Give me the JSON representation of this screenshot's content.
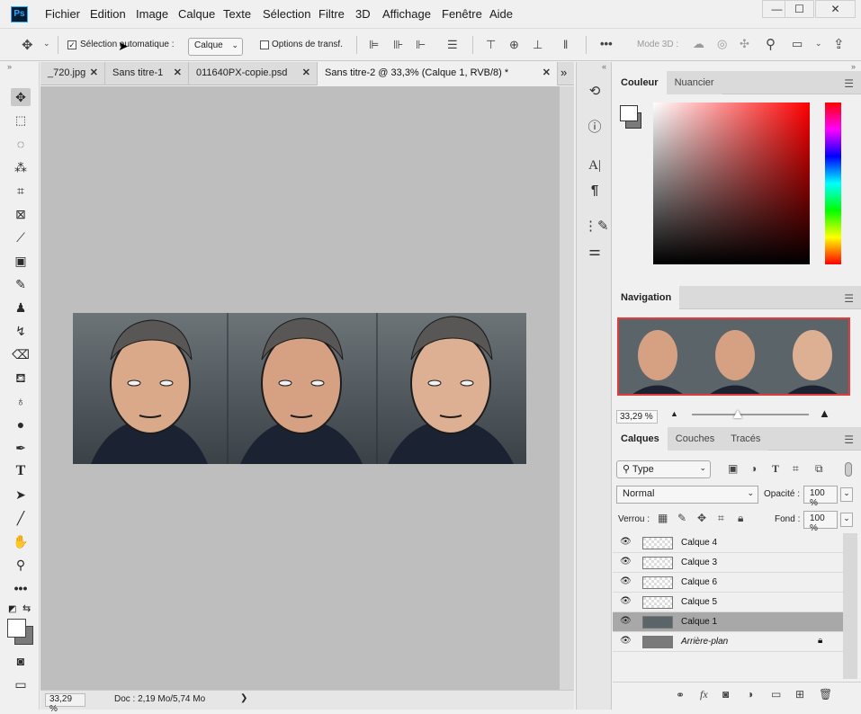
{
  "app": {
    "logo": "Ps"
  },
  "menu": [
    "Fichier",
    "Edition",
    "Image",
    "Calque",
    "Texte",
    "Sélection",
    "Filtre",
    "3D",
    "Affichage",
    "Fenêtre",
    "Aide"
  ],
  "window_controls": {
    "minimize": "—",
    "maximize": "☐",
    "close": "✕"
  },
  "options": {
    "auto_select_label": "Sélection automatique :",
    "auto_select_checked": true,
    "auto_select_value": "Calque",
    "transform_label": "Options de transf.",
    "transform_checked": false,
    "mode3d_label": "Mode 3D :",
    "more": "•••"
  },
  "tabs": [
    {
      "label": "_720.jpg",
      "active": false
    },
    {
      "label": "Sans titre-1",
      "active": false
    },
    {
      "label": "011640PX-copie.psd",
      "active": false
    },
    {
      "label": "Sans titre-2 @ 33,3% (Calque 1, RVB/8) *",
      "active": true
    }
  ],
  "tab_overflow": "»",
  "status": {
    "zoom": "33,29 %",
    "doc": "Doc : 2,19 Mo/5,74 Mo",
    "arrow": "❯"
  },
  "color_panel": {
    "tabs": [
      "Couleur",
      "Nuancier"
    ],
    "active": "Couleur",
    "foreground": "#ffffff",
    "background": "#7a7a7a"
  },
  "navigation_panel": {
    "title": "Navigation",
    "zoom": "33,29 %",
    "proxy_color": "#e23b3b"
  },
  "layers_panel": {
    "tabs": [
      "Calques",
      "Couches",
      "Tracés"
    ],
    "active": "Calques",
    "filter_label": "Type",
    "blend_mode": "Normal",
    "opacity_label": "Opacité :",
    "opacity_value": "100 %",
    "lock_label": "Verrou :",
    "fill_label": "Fond :",
    "fill_value": "100 %",
    "layers": [
      {
        "name": "Calque 4",
        "selected": false,
        "italic": false
      },
      {
        "name": "Calque 3",
        "selected": false,
        "italic": false
      },
      {
        "name": "Calque 6",
        "selected": false,
        "italic": false
      },
      {
        "name": "Calque 5",
        "selected": false,
        "italic": false
      },
      {
        "name": "Calque 1",
        "selected": true,
        "italic": false
      },
      {
        "name": "Arrière-plan",
        "selected": false,
        "italic": true,
        "locked": true
      }
    ],
    "footer_fx": "fx"
  },
  "colors": {
    "accent": "#31a8ff",
    "canvas_bg": "#bebebe",
    "ui_bg": "#f0f0f0"
  }
}
